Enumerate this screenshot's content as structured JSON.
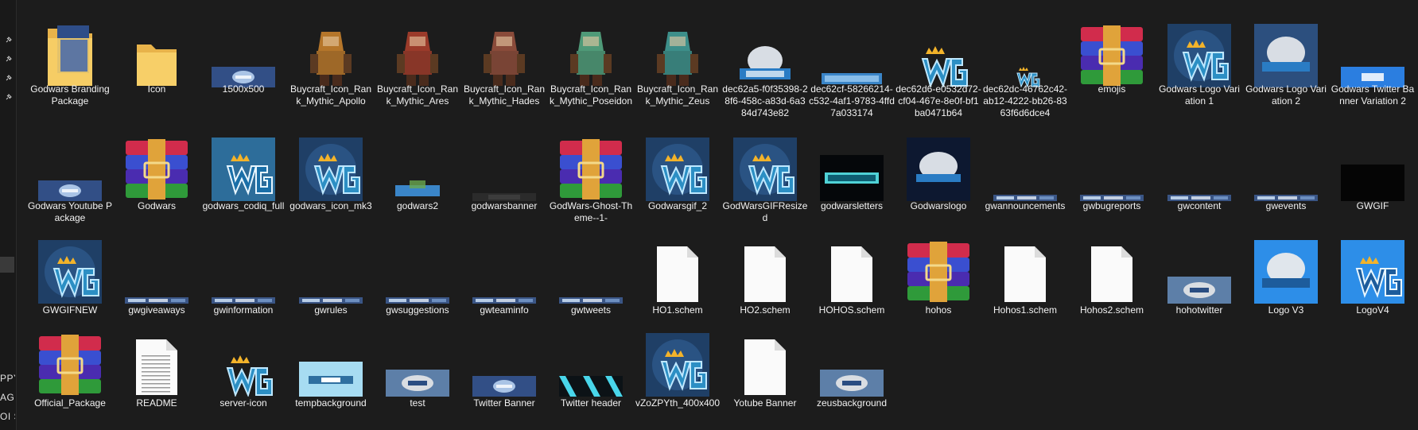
{
  "nav": {
    "fragments": [
      "PPY",
      "AGE I",
      "OI S"
    ]
  },
  "rows": [
    [
      {
        "label": "Godwars Branding Package",
        "type": "folder-doc"
      },
      {
        "label": "Icon",
        "type": "folder"
      },
      {
        "label": "1500x500",
        "type": "banner"
      },
      {
        "label": "Buycraft_Icon_Rank_Mythic_Apollo",
        "type": "figure",
        "color": "#b5762a"
      },
      {
        "label": "Buycraft_Icon_Rank_Mythic_Ares",
        "type": "figure",
        "color": "#9b3b2a"
      },
      {
        "label": "Buycraft_Icon_Rank_Mythic_Hades",
        "type": "figure",
        "color": "#8a4b3a"
      },
      {
        "label": "Buycraft_Icon_Rank_Mythic_Poseidon",
        "type": "figure",
        "color": "#4f9a78"
      },
      {
        "label": "Buycraft_Icon_Rank_Mythic_Zeus",
        "type": "figure",
        "color": "#3d8f8a"
      },
      {
        "label": "dec62a5-f0f35398-28f6-458c-a83d-6a384d743e82",
        "type": "logo-art"
      },
      {
        "label": "dec62cf-58266214-c532-4af1-9783-4ffd7a033174",
        "type": "godwars-text"
      },
      {
        "label": "dec62d6-e0532d72-cf04-467e-8e0f-bf1ba0471b64",
        "type": "gw"
      },
      {
        "label": "dec62dc-46762c42-ab12-4222-bb26-8363f6d6dce4",
        "type": "gw-small"
      },
      {
        "label": "emojis",
        "type": "rar"
      },
      {
        "label": "Godwars Logo Variation 1",
        "type": "gw-box"
      },
      {
        "label": "Godwars Logo Variation 2",
        "type": "logo-box"
      },
      {
        "label": "Godwars Twitter Banner Variation 2",
        "type": "blue-banner"
      }
    ],
    [
      {
        "label": "Godwars Youtube Package",
        "type": "banner"
      },
      {
        "label": "Godwars",
        "type": "rar"
      },
      {
        "label": "godwars_codiq_full",
        "type": "gw-teal"
      },
      {
        "label": "godwars_icon_mk3",
        "type": "gw-box"
      },
      {
        "label": "godwars2",
        "type": "godwars-small"
      },
      {
        "label": "godwarsbanner",
        "type": "dark-banner"
      },
      {
        "label": "GodWars-Ghost-Theme--1-",
        "type": "rar"
      },
      {
        "label": "Godwarsgif_2",
        "type": "gw-box"
      },
      {
        "label": "GodWarsGIFResized",
        "type": "gw-box"
      },
      {
        "label": "godwarsletters",
        "type": "letters"
      },
      {
        "label": "Godwarslogo",
        "type": "logo-dark"
      },
      {
        "label": "gwannouncements",
        "type": "thin-banner"
      },
      {
        "label": "gwbugreports",
        "type": "thin-banner"
      },
      {
        "label": "gwcontent",
        "type": "thin-banner"
      },
      {
        "label": "gwevents",
        "type": "thin-banner"
      },
      {
        "label": "GWGIF",
        "type": "black"
      }
    ],
    [
      {
        "label": "GWGIFNEW",
        "type": "gw-box"
      },
      {
        "label": "gwgiveaways",
        "type": "thin-banner"
      },
      {
        "label": "gwinformation",
        "type": "thin-banner"
      },
      {
        "label": "gwrules",
        "type": "thin-banner"
      },
      {
        "label": "gwsuggestions",
        "type": "thin-banner"
      },
      {
        "label": "gwteaminfo",
        "type": "thin-banner"
      },
      {
        "label": "gwtweets",
        "type": "thin-banner"
      },
      {
        "label": "HO1.schem",
        "type": "file"
      },
      {
        "label": "HO2.schem",
        "type": "file"
      },
      {
        "label": "HOHOS.schem",
        "type": "file"
      },
      {
        "label": "hohos",
        "type": "rar"
      },
      {
        "label": "Hohos1.schem",
        "type": "file"
      },
      {
        "label": "Hohos2.schem",
        "type": "file"
      },
      {
        "label": "hohotwitter",
        "type": "banner-art"
      },
      {
        "label": "Logo V3",
        "type": "logo-bright"
      },
      {
        "label": "LogoV4",
        "type": "gw-bright"
      }
    ],
    [
      {
        "label": "Official_Package",
        "type": "rar"
      },
      {
        "label": "README",
        "type": "text-file"
      },
      {
        "label": "server-icon",
        "type": "gw"
      },
      {
        "label": "tempbackground",
        "type": "light-banner"
      },
      {
        "label": "test",
        "type": "banner-art"
      },
      {
        "label": "Twitter Banner",
        "type": "banner"
      },
      {
        "label": "Twitter header",
        "type": "cyan-banner"
      },
      {
        "label": "vZoZPYth_400x400",
        "type": "gw-box"
      },
      {
        "label": "Yotube Banner",
        "type": "file"
      },
      {
        "label": "zeusbackground",
        "type": "banner-art"
      }
    ]
  ]
}
